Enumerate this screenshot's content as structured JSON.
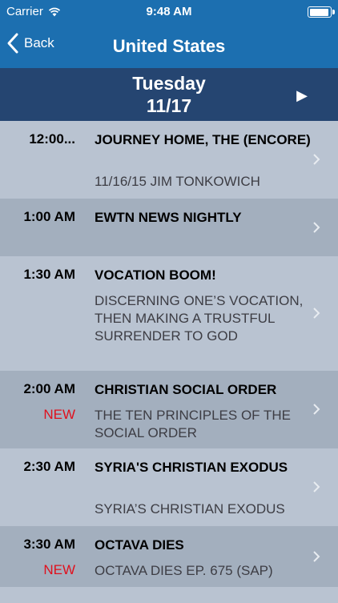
{
  "status_bar": {
    "carrier": "Carrier",
    "time": "9:48 AM"
  },
  "nav": {
    "back_label": "Back",
    "title": "United States"
  },
  "day_header": {
    "day": "Tuesday",
    "date": "11/17",
    "next_symbol": "▶"
  },
  "schedule": [
    {
      "time": "12:00...",
      "title": "JOURNEY HOME, THE (ENCORE)",
      "subtitle": "11/16/15 JIM TONKOWICH",
      "new": ""
    },
    {
      "time": "1:00 AM",
      "title": "EWTN NEWS NIGHTLY",
      "subtitle": "",
      "new": ""
    },
    {
      "time": "1:30 AM",
      "title": "VOCATION BOOM!",
      "subtitle": "DISCERNING ONE’S VOCATION, THEN MAKING A TRUSTFUL SURRENDER TO GOD",
      "new": ""
    },
    {
      "time": "2:00 AM",
      "title": "CHRISTIAN SOCIAL ORDER",
      "subtitle": "THE TEN PRINCIPLES OF THE SOCIAL ORDER",
      "new": "NEW"
    },
    {
      "time": "2:30 AM",
      "title": "SYRIA'S CHRISTIAN EXODUS",
      "subtitle": "SYRIA’S CHRISTIAN EXODUS",
      "new": ""
    },
    {
      "time": "3:30 AM",
      "title": "OCTAVA DIES",
      "subtitle": "OCTAVA DIES EP. 675 (SAP)",
      "new": "NEW"
    }
  ],
  "colors": {
    "nav_blue": "#1c6fb0",
    "day_header_navy": "#254571",
    "row_light": "#b9c3d1",
    "row_dark": "#a3afbe",
    "new_red": "#e0101d"
  }
}
